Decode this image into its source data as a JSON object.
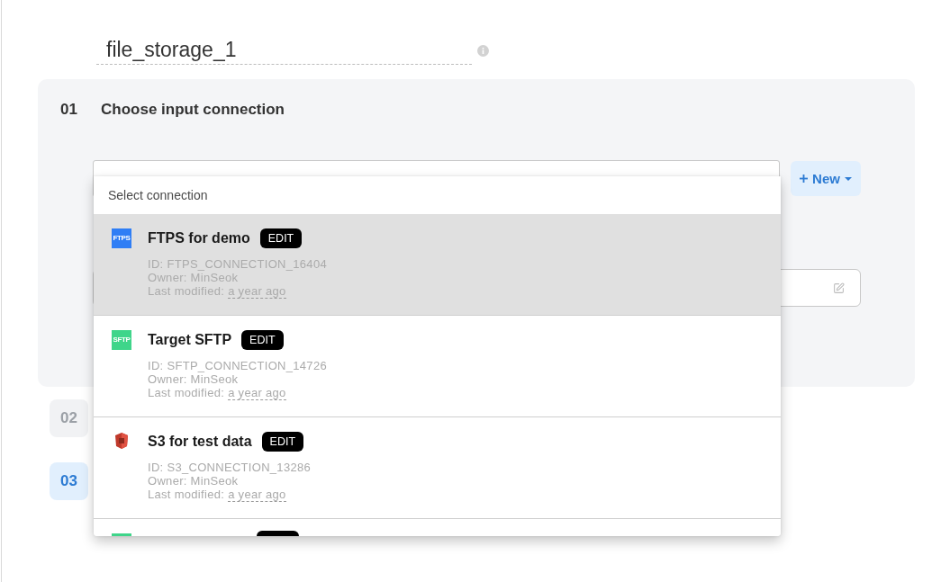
{
  "pipeline_name": "file_storage_1",
  "step_1": {
    "number": "01",
    "title": "Choose input connection"
  },
  "new_button": {
    "label": "New"
  },
  "connection_search": {
    "placeholder": "Select connection"
  },
  "connections": [
    {
      "kind": "full",
      "logo": {
        "kind": "tile_blue",
        "text": "FTPS"
      },
      "name": "FTPS for demo",
      "edit_label": "EDIT",
      "id_line": "ID: FTPS_CONNECTION_16404",
      "owner_line": "Owner: MinSeok",
      "modified_label": "Last modified:",
      "modified_time": "a year ago",
      "selected": true
    },
    {
      "kind": "full",
      "logo": {
        "kind": "tile_green",
        "text": "SFTP"
      },
      "name": "Target SFTP",
      "edit_label": "EDIT",
      "id_line": "ID: SFTP_CONNECTION_14726",
      "owner_line": "Owner: MinSeok",
      "modified_label": "Last modified:",
      "modified_time": "a year ago",
      "selected": false
    },
    {
      "kind": "full",
      "logo": {
        "kind": "bucket"
      },
      "name": "S3 for test data",
      "edit_label": "EDIT",
      "id_line": "ID: S3_CONNECTION_13286",
      "owner_line": "Owner: MinSeok",
      "modified_label": "Last modified:",
      "modified_time": "a year ago",
      "selected": false
    },
    {
      "kind": "cut_off",
      "logo": {
        "kind": "tile_green"
      },
      "selected": false
    }
  ],
  "later_steps": [
    {
      "number": "02",
      "active": false
    },
    {
      "number": "03",
      "active": true
    }
  ]
}
